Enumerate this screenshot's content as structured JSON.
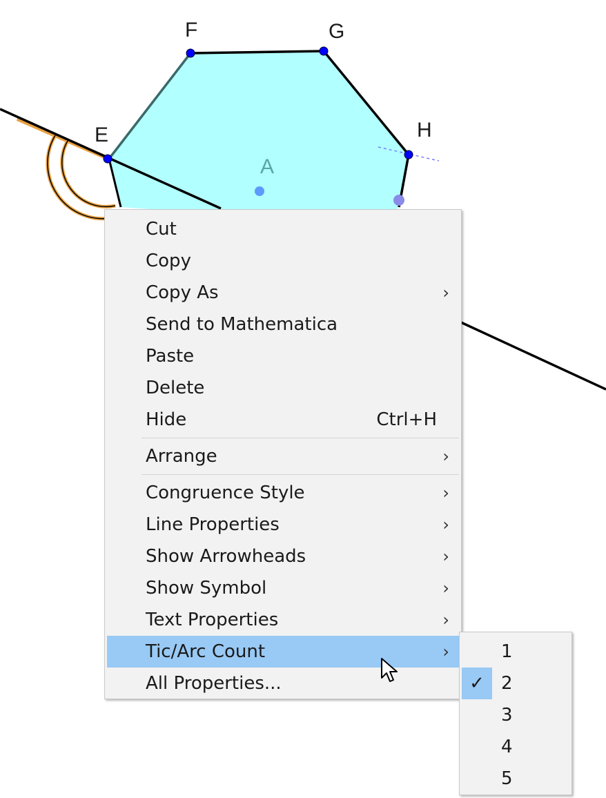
{
  "canvas": {
    "points": {
      "F": "F",
      "G": "G",
      "H": "H",
      "E": "E",
      "A": "A"
    },
    "colors": {
      "polygon_fill": "#b2ffff",
      "vertex": "#0000ff",
      "center_point": "#5b9bff",
      "label": "#1a1a1a",
      "center_label": "#5aa5a5",
      "angle_mark": "#e8a040",
      "line": "#000000"
    }
  },
  "context_menu": {
    "groups": [
      [
        {
          "label": "Cut"
        },
        {
          "label": "Copy"
        },
        {
          "label": "Copy As",
          "submenu": true
        },
        {
          "label": "Send to Mathematica"
        },
        {
          "label": "Paste"
        },
        {
          "label": "Delete"
        },
        {
          "label": "Hide",
          "shortcut": "Ctrl+H"
        }
      ],
      [
        {
          "label": "Arrange",
          "submenu": true
        }
      ],
      [
        {
          "label": "Congruence Style",
          "submenu": true
        },
        {
          "label": "Line Properties",
          "submenu": true
        },
        {
          "label": "Show Arrowheads",
          "submenu": true
        },
        {
          "label": "Show Symbol",
          "submenu": true
        },
        {
          "label": "Text Properties",
          "submenu": true
        },
        {
          "label": "Tic/Arc Count",
          "submenu": true,
          "highlighted": true
        },
        {
          "label": "All Properties..."
        }
      ]
    ],
    "chevron": "›"
  },
  "submenu": {
    "items": [
      {
        "label": "1",
        "checked": false
      },
      {
        "label": "2",
        "checked": true
      },
      {
        "label": "3",
        "checked": false
      },
      {
        "label": "4",
        "checked": false
      },
      {
        "label": "5",
        "checked": false
      }
    ],
    "check_glyph": "✓",
    "highlight_color": "#99c9f5"
  }
}
